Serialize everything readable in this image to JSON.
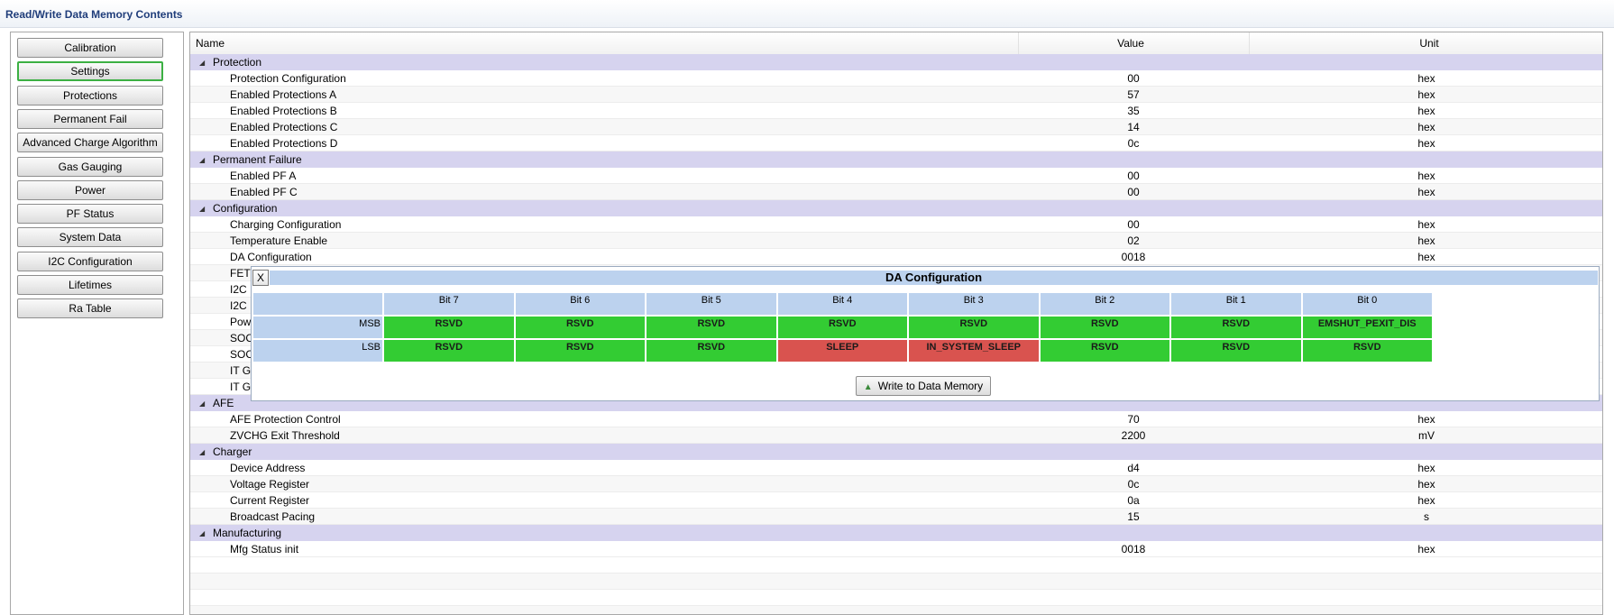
{
  "window": {
    "title": "Read/Write Data Memory Contents"
  },
  "sidebar": {
    "items": [
      {
        "label": "Calibration",
        "active": false
      },
      {
        "label": "Settings",
        "active": true
      },
      {
        "label": "Protections",
        "active": false
      },
      {
        "label": "Permanent Fail",
        "active": false
      },
      {
        "label": "Advanced Charge Algorithm",
        "active": false
      },
      {
        "label": "Gas Gauging",
        "active": false
      },
      {
        "label": "Power",
        "active": false
      },
      {
        "label": "PF Status",
        "active": false
      },
      {
        "label": "System Data",
        "active": false
      },
      {
        "label": "I2C Configuration",
        "active": false
      },
      {
        "label": "Lifetimes",
        "active": false
      },
      {
        "label": "Ra Table",
        "active": false
      }
    ]
  },
  "table": {
    "headers": {
      "name": "Name",
      "value": "Value",
      "unit": "Unit"
    },
    "rows": [
      {
        "type": "category",
        "name": "Protection"
      },
      {
        "type": "item",
        "name": "Protection Configuration",
        "value": "00",
        "unit": "hex"
      },
      {
        "type": "item",
        "name": "Enabled Protections A",
        "value": "57",
        "unit": "hex"
      },
      {
        "type": "item",
        "name": "Enabled Protections B",
        "value": "35",
        "unit": "hex"
      },
      {
        "type": "item",
        "name": "Enabled Protections C",
        "value": "14",
        "unit": "hex"
      },
      {
        "type": "item",
        "name": "Enabled Protections D",
        "value": "0c",
        "unit": "hex"
      },
      {
        "type": "category",
        "name": "Permanent Failure"
      },
      {
        "type": "item",
        "name": "Enabled PF A",
        "value": "00",
        "unit": "hex"
      },
      {
        "type": "item",
        "name": "Enabled PF C",
        "value": "00",
        "unit": "hex"
      },
      {
        "type": "category",
        "name": "Configuration"
      },
      {
        "type": "item",
        "name": "Charging Configuration",
        "value": "00",
        "unit": "hex"
      },
      {
        "type": "item",
        "name": "Temperature Enable",
        "value": "02",
        "unit": "hex"
      },
      {
        "type": "item",
        "name": "DA Configuration",
        "value": "0018",
        "unit": "hex"
      },
      {
        "type": "item",
        "name": "FET",
        "value": "",
        "unit": ""
      },
      {
        "type": "item",
        "name": "I2C",
        "value": "",
        "unit": ""
      },
      {
        "type": "item",
        "name": "I2C",
        "value": "",
        "unit": ""
      },
      {
        "type": "item",
        "name": "Pow",
        "value": "",
        "unit": ""
      },
      {
        "type": "item",
        "name": "SOC",
        "value": "",
        "unit": ""
      },
      {
        "type": "item",
        "name": "SOC",
        "value": "",
        "unit": ""
      },
      {
        "type": "item",
        "name": "IT G",
        "value": "",
        "unit": ""
      },
      {
        "type": "item",
        "name": "IT G",
        "value": "",
        "unit": ""
      },
      {
        "type": "category",
        "name": "AFE"
      },
      {
        "type": "item",
        "name": "AFE Protection Control",
        "value": "70",
        "unit": "hex"
      },
      {
        "type": "item",
        "name": "ZVCHG Exit Threshold",
        "value": "2200",
        "unit": "mV"
      },
      {
        "type": "category",
        "name": "Charger"
      },
      {
        "type": "item",
        "name": "Device Address",
        "value": "d4",
        "unit": "hex"
      },
      {
        "type": "item",
        "name": "Voltage Register",
        "value": "0c",
        "unit": "hex"
      },
      {
        "type": "item",
        "name": "Current Register",
        "value": "0a",
        "unit": "hex"
      },
      {
        "type": "item",
        "name": "Broadcast Pacing",
        "value": "15",
        "unit": "s"
      },
      {
        "type": "category",
        "name": "Manufacturing"
      },
      {
        "type": "item",
        "name": "Mfg Status init",
        "value": "0018",
        "unit": "hex"
      }
    ]
  },
  "popup": {
    "close_label": "X",
    "title": "DA Configuration",
    "columns": [
      "Bit 7",
      "Bit 6",
      "Bit 5",
      "Bit 4",
      "Bit 3",
      "Bit 2",
      "Bit 1",
      "Bit 0"
    ],
    "rows": [
      {
        "label": "MSB",
        "bits": [
          {
            "name": "RSVD",
            "set": false
          },
          {
            "name": "RSVD",
            "set": false
          },
          {
            "name": "RSVD",
            "set": false
          },
          {
            "name": "RSVD",
            "set": false
          },
          {
            "name": "RSVD",
            "set": false
          },
          {
            "name": "RSVD",
            "set": false
          },
          {
            "name": "RSVD",
            "set": false
          },
          {
            "name": "EMSHUT_PEXIT_DIS",
            "set": false
          }
        ]
      },
      {
        "label": "LSB",
        "bits": [
          {
            "name": "RSVD",
            "set": false
          },
          {
            "name": "RSVD",
            "set": false
          },
          {
            "name": "RSVD",
            "set": false
          },
          {
            "name": "SLEEP",
            "set": true
          },
          {
            "name": "IN_SYSTEM_SLEEP",
            "set": true
          },
          {
            "name": "RSVD",
            "set": false
          },
          {
            "name": "RSVD",
            "set": false
          },
          {
            "name": "RSVD",
            "set": false
          }
        ]
      }
    ],
    "write_button": {
      "label": "Write to Data Memory",
      "icon": "up-arrow-icon"
    },
    "colors": {
      "clear": "#33cc33",
      "set": "#d9534f",
      "header": "#bcd2ee"
    }
  }
}
